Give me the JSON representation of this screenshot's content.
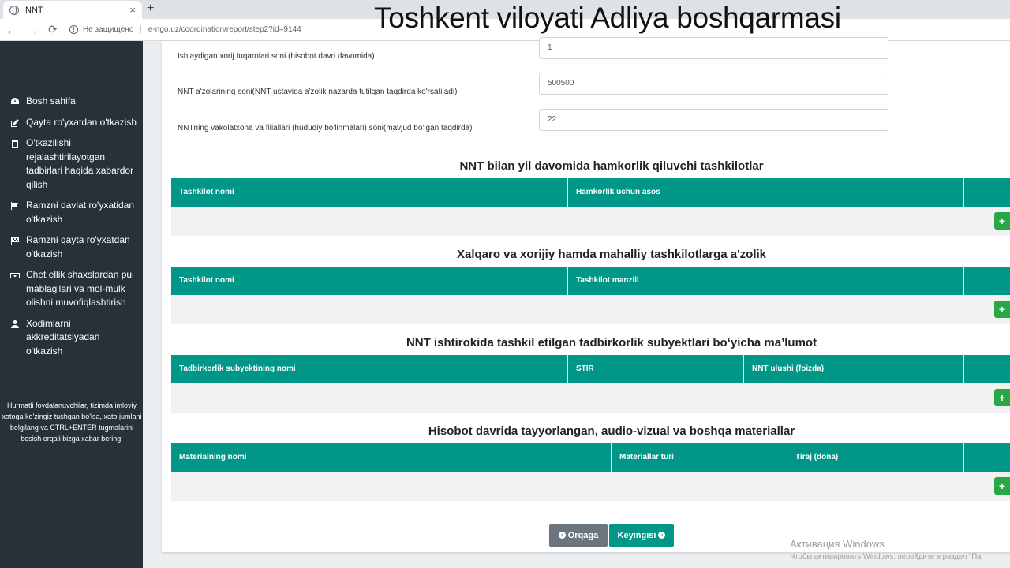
{
  "browser": {
    "tab_title": "NNT",
    "tab_close": "×",
    "new_tab": "+",
    "back": "←",
    "forward": "→",
    "reload": "⟳",
    "security_label": "Не защищено",
    "separator": "|",
    "url": "e-ngo.uz/coordination/report/step2?id=9144"
  },
  "video_title": "Toshkent viloyati Adliya boshqarmasi",
  "sidebar": {
    "items": [
      {
        "label": "Bosh sahifa",
        "icon": "dashboard-icon"
      },
      {
        "label": "Qayta ro'yxatdan o'tkazish",
        "icon": "edit-icon"
      },
      {
        "label": "O'tkazilishi rejalashtirilayotgan tadbirlari haqida xabardor qilish",
        "icon": "calendar-icon"
      },
      {
        "label": "Ramzni davlat ro'yxatidan o'tkazish",
        "icon": "flag-icon"
      },
      {
        "label": "Ramzni qayta ro'yxatdan o'tkazish",
        "icon": "checkered-flag-icon"
      },
      {
        "label": "Chet ellik shaxslardan pul mablag'lari va mol-mulk olishni muvofiqlashtirish",
        "icon": "money-icon"
      },
      {
        "label": "Xodimlarni akkreditatsiyadan o'tkazish",
        "icon": "user-icon"
      }
    ],
    "note": "Hurmatli foydalanuvchilar, tizimda imloviy xatoga ko'zingiz tushgan bo'lsa, xato jumlani belgilang va CTRL+ENTER tugmalarini bosish orqali bizga xabar bering."
  },
  "fields": [
    {
      "label": "Ishlaydigan xorij fuqarolari soni (hisobot davri davomida)",
      "value": "1"
    },
    {
      "label": "NNT a'zolarining soni(NNT ustavida a'zolik nazarda tutilgan taqdirda ko'rsatiladi)",
      "value": "500500"
    },
    {
      "label": "NNTning vakolatxona va filiallari (hududiy bo'linmalari) soni(mavjud bo'lgan taqdirda)",
      "value": "22"
    }
  ],
  "sections": [
    {
      "title": "NNT bilan yil davomida hamkorlik qiluvchi tashkilotlar",
      "columns": [
        "Tashkilot nomi",
        "Hamkorlik uchun asos",
        ""
      ]
    },
    {
      "title": "Xalqaro va xorijiy hamda mahalliy tashkilotlarga a'zolik",
      "columns": [
        "Tashkilot nomi",
        "Tashkilot manzili",
        ""
      ]
    },
    {
      "title": "NNT ishtirokida tashkil etilgan tadbirkorlik subyektlari bo‘yicha ma’lumot",
      "columns": [
        "Tadbirkorlik subyektining nomi",
        "STIR",
        "NNT ulushi (foizda)",
        ""
      ]
    },
    {
      "title": "Hisobot davrida tayyorlangan, audio-vizual va boshqa materiallar",
      "columns": [
        "Materialning nomi",
        "Materiallar turi",
        "Tiraj (dona)",
        ""
      ]
    }
  ],
  "add_label": "+",
  "buttons": {
    "back": "Orqaga",
    "back_icon": "‹",
    "next": "Keyingisi",
    "next_icon": "›"
  },
  "watermark": {
    "line1": "Активация Windows",
    "line2": "Чтобы активировать Windows, перейдите в раздел \"Па"
  }
}
